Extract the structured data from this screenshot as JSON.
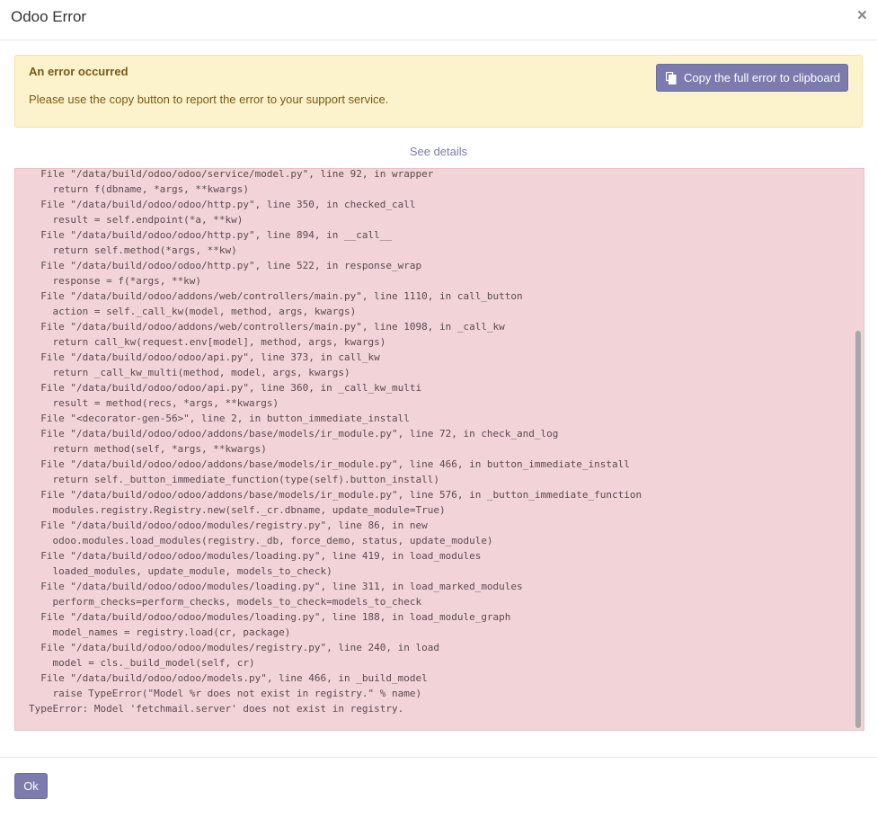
{
  "dialog": {
    "title": "Odoo Error",
    "close_label": "×"
  },
  "alert": {
    "title": "An error occurred",
    "text": "Please use the copy button to report the error to your support service.",
    "copy_button_label": "Copy the full error to clipboard"
  },
  "details": {
    "link_label": "See details",
    "traceback_lines": [
      "  File \"/data/build/odoo/odoo/service/model.py\", line 92, in wrapper",
      "    return f(dbname, *args, **kwargs)",
      "  File \"/data/build/odoo/odoo/http.py\", line 350, in checked_call",
      "    result = self.endpoint(*a, **kw)",
      "  File \"/data/build/odoo/odoo/http.py\", line 894, in __call__",
      "    return self.method(*args, **kw)",
      "  File \"/data/build/odoo/odoo/http.py\", line 522, in response_wrap",
      "    response = f(*args, **kw)",
      "  File \"/data/build/odoo/addons/web/controllers/main.py\", line 1110, in call_button",
      "    action = self._call_kw(model, method, args, kwargs)",
      "  File \"/data/build/odoo/addons/web/controllers/main.py\", line 1098, in _call_kw",
      "    return call_kw(request.env[model], method, args, kwargs)",
      "  File \"/data/build/odoo/odoo/api.py\", line 373, in call_kw",
      "    return _call_kw_multi(method, model, args, kwargs)",
      "  File \"/data/build/odoo/odoo/api.py\", line 360, in _call_kw_multi",
      "    result = method(recs, *args, **kwargs)",
      "  File \"<decorator-gen-56>\", line 2, in button_immediate_install",
      "  File \"/data/build/odoo/odoo/addons/base/models/ir_module.py\", line 72, in check_and_log",
      "    return method(self, *args, **kwargs)",
      "  File \"/data/build/odoo/odoo/addons/base/models/ir_module.py\", line 466, in button_immediate_install",
      "    return self._button_immediate_function(type(self).button_install)",
      "  File \"/data/build/odoo/odoo/addons/base/models/ir_module.py\", line 576, in _button_immediate_function",
      "    modules.registry.Registry.new(self._cr.dbname, update_module=True)",
      "  File \"/data/build/odoo/odoo/modules/registry.py\", line 86, in new",
      "    odoo.modules.load_modules(registry._db, force_demo, status, update_module)",
      "  File \"/data/build/odoo/odoo/modules/loading.py\", line 419, in load_modules",
      "    loaded_modules, update_module, models_to_check)",
      "  File \"/data/build/odoo/odoo/modules/loading.py\", line 311, in load_marked_modules",
      "    perform_checks=perform_checks, models_to_check=models_to_check",
      "  File \"/data/build/odoo/odoo/modules/loading.py\", line 188, in load_module_graph",
      "    model_names = registry.load(cr, package)",
      "  File \"/data/build/odoo/odoo/modules/registry.py\", line 240, in load",
      "    model = cls._build_model(self, cr)",
      "  File \"/data/build/odoo/odoo/models.py\", line 466, in _build_model",
      "    raise TypeError(\"Model %r does not exist in registry.\" % name)",
      "TypeError: Model 'fetchmail.server' does not exist in registry."
    ]
  },
  "footer": {
    "ok_label": "Ok"
  },
  "colors": {
    "primary": "#7c7bad",
    "alert_bg": "#fcf2cc",
    "alert_text": "#7a5a15",
    "trace_bg": "#f2d4d8"
  },
  "icons": {
    "copy": "clipboard-icon",
    "close": "close-icon"
  }
}
